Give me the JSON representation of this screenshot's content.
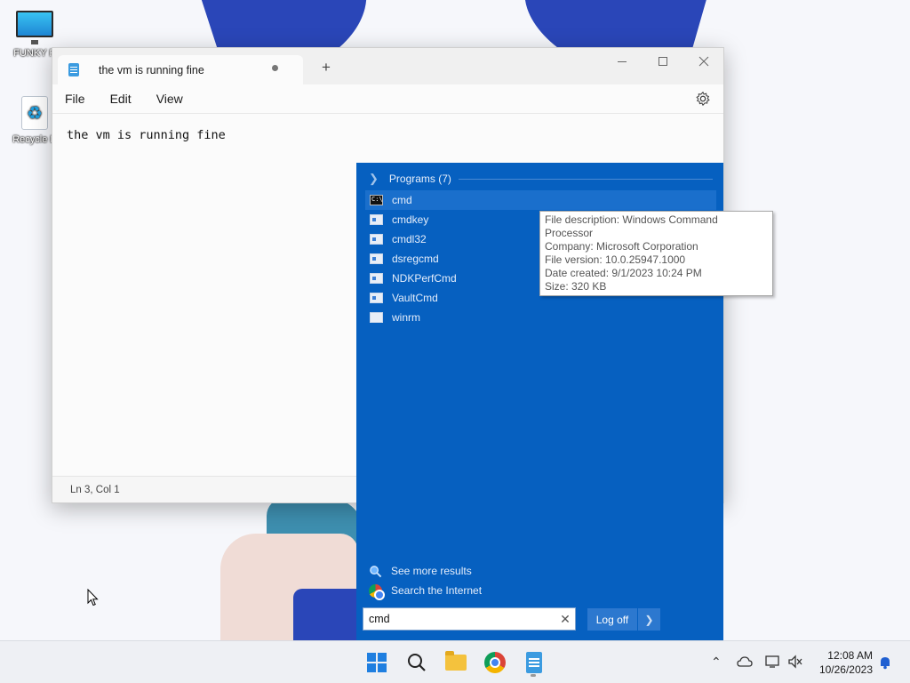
{
  "desktop": {
    "icons": [
      {
        "label": "FUNKY P"
      },
      {
        "label": "Recycle B"
      }
    ]
  },
  "notepad": {
    "tab_title": "the vm is running fine",
    "menu": [
      "File",
      "Edit",
      "View"
    ],
    "content": "the vm is running fine",
    "status": "Ln 3, Col 1"
  },
  "search_panel": {
    "programs_header": "Programs (7)",
    "programs": [
      {
        "name": "cmd",
        "icon": "cmd-icon"
      },
      {
        "name": "cmdkey",
        "icon": "exe-icon"
      },
      {
        "name": "cmdl32",
        "icon": "exe-icon"
      },
      {
        "name": "dsregcmd",
        "icon": "exe-icon"
      },
      {
        "name": "NDKPerfCmd",
        "icon": "exe-icon"
      },
      {
        "name": "VaultCmd",
        "icon": "exe-icon"
      },
      {
        "name": "winrm",
        "icon": "script-icon"
      }
    ],
    "tooltip": {
      "description": "File description: Windows Command Processor",
      "company": "Company: Microsoft Corporation",
      "version": "File version: 10.0.25947.1000",
      "date": "Date created: 9/1/2023 10:24 PM",
      "size": "Size: 320 KB"
    },
    "see_more": "See more results",
    "search_internet": "Search the Internet",
    "search_value": "cmd",
    "logoff_label": "Log off",
    "accent": "#0660c0"
  },
  "taskbar": {
    "time": "12:08 AM",
    "date": "10/26/2023",
    "apps": [
      "start-icon",
      "search-icon",
      "file-explorer-icon",
      "chrome-icon",
      "notepad-icon"
    ]
  }
}
